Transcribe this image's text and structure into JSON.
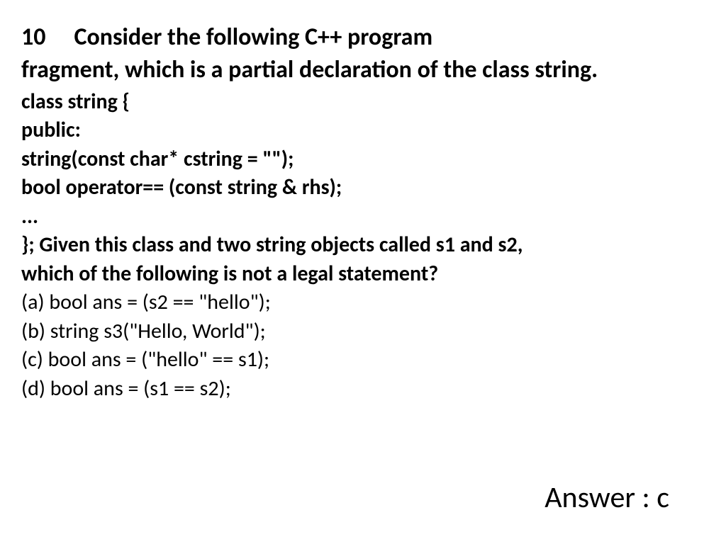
{
  "question": {
    "number": "10",
    "prompt_part1": "Consider the following C++ program",
    "prompt_part2": "fragment, which is a partial declaration of the class string."
  },
  "code": {
    "l1": "class string {",
    "l2": "public:",
    "l3": "string(const char* cstring = \"\");",
    "l4": "bool operator== (const string & rhs);",
    "l5": "..."
  },
  "sub": {
    "l1": "};  Given this class and two string objects called s1 and s2,",
    "l2": "which of the following is not a legal statement?"
  },
  "options": {
    "a": "(a) bool ans = (s2 == \"hello\");",
    "b": "(b) string s3(\"Hello, World\");",
    "c": "(c) bool ans = (\"hello\" == s1);",
    "d": "(d) bool ans = (s1 == s2);"
  },
  "answer": "Answer : c"
}
